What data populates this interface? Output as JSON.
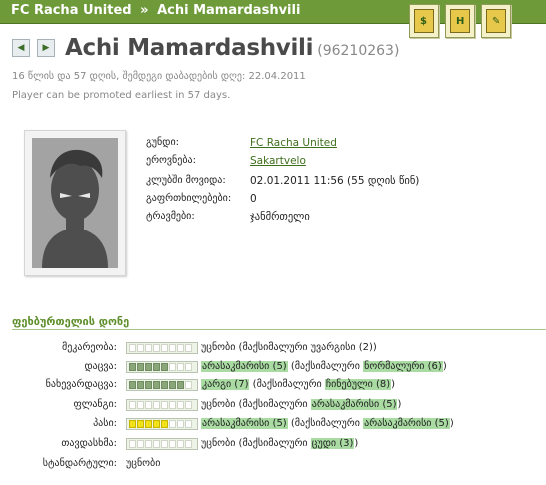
{
  "breadcrumb": {
    "team": "FC Racha United",
    "separator": "»",
    "player": "Achi Mamardashvili"
  },
  "toolbar": {
    "buttons": [
      {
        "name": "transfer-tool-icon",
        "symbol": "$"
      },
      {
        "name": "html-export-icon",
        "symbol": "H"
      },
      {
        "name": "stats-tool-icon",
        "symbol": "✎"
      }
    ]
  },
  "player": {
    "name": "Achi Mamardashvili",
    "id": "(96210263)",
    "age_line": "16 წლის და 57 დღის, შემდეგი დაბადების დღე: 22.04.2011",
    "promotion_line": "Player can be promoted earliest in 57 days."
  },
  "info": [
    {
      "label": "გუნდი:",
      "value": "FC Racha United",
      "link": true
    },
    {
      "label": "ეროვნება:",
      "value": "Sakartvelo",
      "link": true
    },
    {
      "label": "კლუბში მოვიდა:",
      "value": "02.01.2011 11:56 (55 დღის წინ)",
      "link": false
    },
    {
      "label": "გაფრთხილებები:",
      "value": "0",
      "link": false
    },
    {
      "label": "ტრავმები:",
      "value": "ჯანმრთელი",
      "link": false
    }
  ],
  "skills_title": "ფეხბურთელის დონე",
  "skills": [
    {
      "label": "მეკარეობა:",
      "level": 0,
      "color": "green",
      "parts": [
        {
          "t": "უცნობი (მაქსიმალური უვარგისი (2))",
          "hl": false
        }
      ]
    },
    {
      "label": "დაცვა:",
      "level": 5,
      "color": "green",
      "parts": [
        {
          "t": "არასაკმარისი (5)",
          "hl": true
        },
        {
          "t": " (მაქსიმალური ",
          "hl": false
        },
        {
          "t": "ნორმალური (6)",
          "hl": true
        },
        {
          "t": ")",
          "hl": false
        }
      ]
    },
    {
      "label": "ნახევარდაცვა:",
      "level": 7,
      "color": "green",
      "parts": [
        {
          "t": "კარგი (7)",
          "hl": true
        },
        {
          "t": " (მაქსიმალური ",
          "hl": false
        },
        {
          "t": "ჩინებული (8)",
          "hl": true
        },
        {
          "t": ")",
          "hl": false
        }
      ]
    },
    {
      "label": "ფლანგი:",
      "level": 0,
      "color": "green",
      "parts": [
        {
          "t": "უცნობი (მაქსიმალური ",
          "hl": false
        },
        {
          "t": "არასაკმარისი (5)",
          "hl": true
        },
        {
          "t": ")",
          "hl": false
        }
      ]
    },
    {
      "label": "პასი:",
      "level": 5,
      "color": "yellow",
      "parts": [
        {
          "t": "არასაკმარისი (5)",
          "hl": true
        },
        {
          "t": " (მაქსიმალური ",
          "hl": false
        },
        {
          "t": "არასაკმარისი (5)",
          "hl": true
        },
        {
          "t": ")",
          "hl": false
        }
      ]
    },
    {
      "label": "თავდასხმა:",
      "level": 0,
      "color": "green",
      "parts": [
        {
          "t": "უცნობი (მაქსიმალური ",
          "hl": false
        },
        {
          "t": "ცუდი (3)",
          "hl": true
        },
        {
          "t": ")",
          "hl": false
        }
      ]
    },
    {
      "label": "სტანდარტული:",
      "level": null,
      "color": "none",
      "parts": [
        {
          "t": "უცნობი",
          "hl": false
        }
      ]
    }
  ]
}
